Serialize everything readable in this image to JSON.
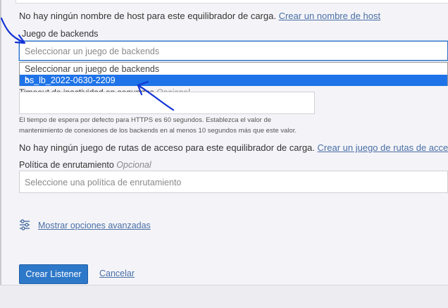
{
  "host": {
    "note": "No hay ningún nombre de host para este equilibrador de carga.",
    "link": "Crear un nombre de host"
  },
  "backend_set": {
    "label": "Juego de backends",
    "placeholder": "Seleccionar un juego de backends",
    "options": [
      {
        "label": "Seleccionar un juego de backends",
        "selected": false
      },
      {
        "label": "bs_lb_2022-0630-2209",
        "selected": true
      }
    ]
  },
  "idle_timeout": {
    "label": "Timeout de inactividad en segundos",
    "optional": "Opcional",
    "help_line1": "El tiempo de espera por defecto para HTTPS es 60 segundos. Establezca el valor de",
    "help_line2": "mantenimiento de conexiones de los backends en al menos 10 segundos más que este valor."
  },
  "route_set": {
    "note": "No hay ningún juego de rutas de acceso para este equilibrador de carga.",
    "link": "Crear un juego de rutas de acceso"
  },
  "routing_policy": {
    "label": "Política de enrutamiento",
    "optional": "Opcional",
    "placeholder": "Seleccione una política de enrutamiento"
  },
  "advanced": {
    "label": "Mostrar opciones avanzadas",
    "icon": "sliders-icon"
  },
  "actions": {
    "create": "Crear Listener",
    "cancel": "Cancelar"
  },
  "annotation_color": "#1434d6"
}
